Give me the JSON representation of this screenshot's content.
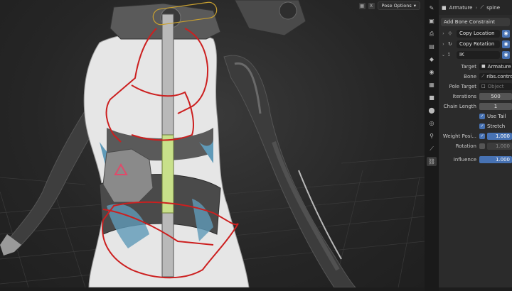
{
  "viewport": {
    "pose_options_label": "Pose Options",
    "header_icons": [
      "fields-icon",
      "close-x-icon"
    ],
    "close_glyph": "X",
    "colors": {
      "annotation": "#cc1f1f",
      "bone": "#b9b9b9",
      "bone_selected": "#c8e08a",
      "background": "#2a2a2a"
    }
  },
  "tabs": [
    {
      "icon": "tool-icon",
      "glyph": "✎",
      "active": false
    },
    {
      "icon": "render-icon",
      "glyph": "▣",
      "active": false
    },
    {
      "icon": "output-icon",
      "glyph": "⎙",
      "active": false
    },
    {
      "icon": "view-layer-icon",
      "glyph": "▤",
      "active": false
    },
    {
      "icon": "scene-icon",
      "glyph": "◆",
      "active": false
    },
    {
      "icon": "world-icon",
      "glyph": "◉",
      "active": false
    },
    {
      "icon": "collection-icon",
      "glyph": "▦",
      "active": false
    },
    {
      "icon": "object-icon",
      "glyph": "■",
      "active": false
    },
    {
      "icon": "modifier-icon",
      "glyph": "⬤",
      "active": false
    },
    {
      "icon": "physics-icon",
      "glyph": "◎",
      "active": false
    },
    {
      "icon": "armature-data-icon",
      "glyph": "⚲",
      "active": false
    },
    {
      "icon": "bone-icon",
      "glyph": "⟋",
      "active": false
    },
    {
      "icon": "bone-constraint-icon",
      "glyph": "⛓",
      "active": true
    }
  ],
  "properties": {
    "breadcrumb": {
      "object": "Armature",
      "bone": "spine"
    },
    "add_constraint_label": "Add Bone Constraint",
    "constraints": [
      {
        "name": "Copy Location",
        "expanded": false
      },
      {
        "name": "Copy Rotation",
        "expanded": false
      },
      {
        "name": "IK",
        "expanded": true
      }
    ],
    "ik": {
      "target_label": "Target",
      "target_value": "Armature",
      "bone_label": "Bone",
      "bone_value": "ribs.control",
      "pole_label": "Pole Target",
      "pole_placeholder": "Object",
      "iterations_label": "Iterations",
      "iterations_value": "500",
      "chain_label": "Chain Length",
      "chain_value": "1",
      "use_tail_label": "Use Tail",
      "stretch_label": "Stretch",
      "weight_pos_label": "Weight Posi...",
      "weight_pos_value": "1.000",
      "rotation_label": "Rotation",
      "rotation_value": "1.000",
      "influence_label": "Influence",
      "influence_value": "1.000"
    }
  }
}
